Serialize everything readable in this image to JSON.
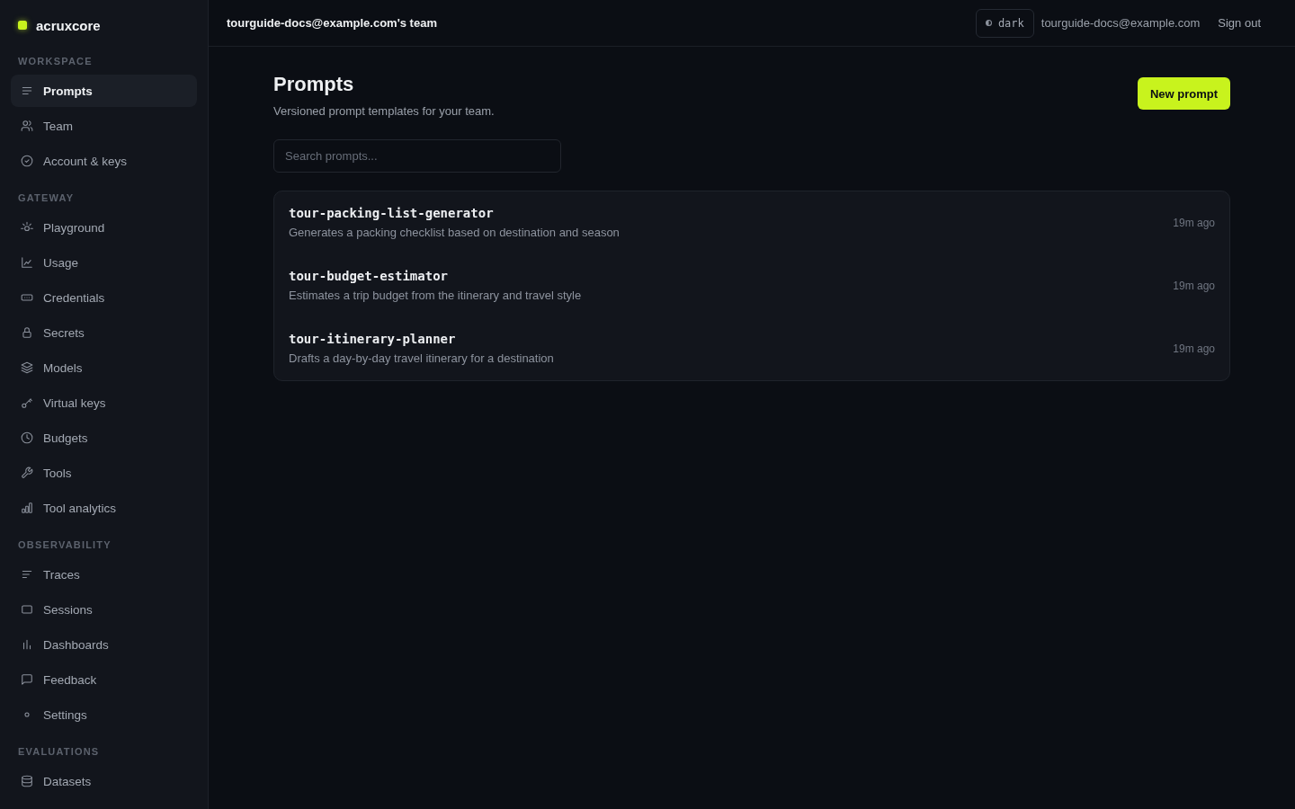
{
  "sidebar": {
    "brand": "acruxcore",
    "sections": [
      {
        "title": "WORKSPACE",
        "items": [
          {
            "label": "Prompts",
            "selected": true
          },
          {
            "label": "Team",
            "selected": false
          },
          {
            "label": "Account & keys",
            "selected": false
          }
        ]
      },
      {
        "title": "GATEWAY",
        "items": [
          {
            "label": "Playground",
            "selected": false
          },
          {
            "label": "Usage",
            "selected": false
          },
          {
            "label": "Credentials",
            "selected": false
          },
          {
            "label": "Secrets",
            "selected": false
          },
          {
            "label": "Models",
            "selected": false
          },
          {
            "label": "Virtual keys",
            "selected": false
          },
          {
            "label": "Budgets",
            "selected": false
          },
          {
            "label": "Tools",
            "selected": false
          },
          {
            "label": "Tool analytics",
            "selected": false
          }
        ]
      },
      {
        "title": "OBSERVABILITY",
        "items": [
          {
            "label": "Traces",
            "selected": false
          },
          {
            "label": "Sessions",
            "selected": false
          },
          {
            "label": "Dashboards",
            "selected": false
          },
          {
            "label": "Feedback",
            "selected": false
          },
          {
            "label": "Settings",
            "selected": false
          }
        ]
      },
      {
        "title": "EVALUATIONS",
        "items": [
          {
            "label": "Datasets",
            "selected": false
          }
        ]
      }
    ]
  },
  "header": {
    "team": "tourguide-docs@example.com's team",
    "theme_toggle": "dark",
    "user_email": "tourguide-docs@example.com",
    "sign_out": "Sign out"
  },
  "page": {
    "title": "Prompts",
    "subtitle": "Versioned prompt templates for your team.",
    "new_button": "New prompt",
    "search": {
      "placeholder": "Search prompts..."
    }
  },
  "prompts": [
    {
      "name": "tour-packing-list-generator",
      "description": "Generates a packing checklist based on destination and season",
      "updated": "19m ago"
    },
    {
      "name": "tour-budget-estimator",
      "description": "Estimates a trip budget from the itinerary and travel style",
      "updated": "19m ago"
    },
    {
      "name": "tour-itinerary-planner",
      "description": "Drafts a day-by-day travel itinerary for a destination",
      "updated": "19m ago"
    }
  ]
}
